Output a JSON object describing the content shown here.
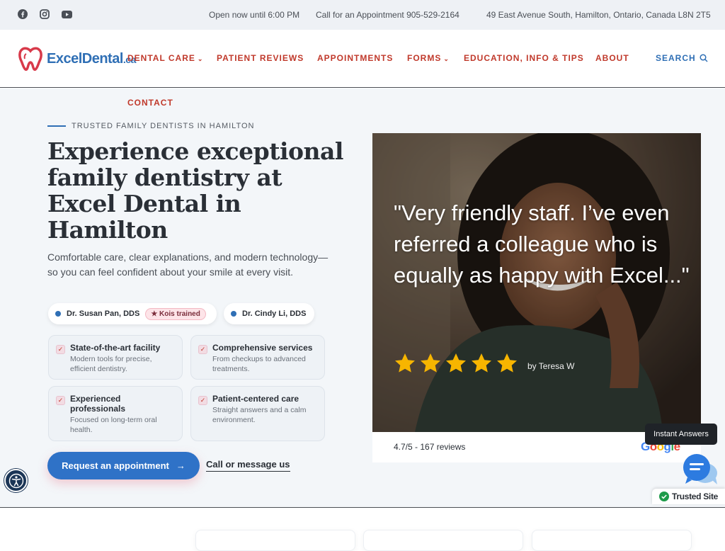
{
  "topbar": {
    "social": [
      "facebook-icon",
      "instagram-icon",
      "youtube-icon"
    ],
    "hours": "Open now until 6:00 PM",
    "phone": "Call for an Appointment  905-529-2164",
    "address": "49 East Avenue South, Hamilton, Ontario, Canada L8N 2T5"
  },
  "brand": {
    "name": "ExcelDental",
    "tld": ".ca",
    "color": "#2f6fb5",
    "accent": "#c0392b"
  },
  "nav": {
    "items": [
      {
        "label": "DENTAL CARE",
        "dropdown": true
      },
      {
        "label": "PATIENT REVIEWS",
        "dropdown": false
      },
      {
        "label": "APPOINTMENTS",
        "dropdown": false
      },
      {
        "label": "FORMS",
        "dropdown": true
      },
      {
        "label": "EDUCATION, INFO & TIPS",
        "dropdown": false
      },
      {
        "label": "ABOUT",
        "dropdown": false
      },
      {
        "label": "CONTACT",
        "dropdown": false
      }
    ],
    "search_label": "SEARCH"
  },
  "hero": {
    "eyebrow": "TRUSTED FAMILY DENTISTS IN HAMILTON",
    "headline": "Experience exceptional family dentistry at Excel Dental in Hamilton",
    "subtext": "Comfortable care, clear explanations, and modern technology—so you can feel confident about your smile at every visit.",
    "doctors": [
      {
        "name": "Dr. Susan Pan, DDS",
        "badge": "★ Kois trained"
      },
      {
        "name": "Dr. Cindy Li, DDS",
        "badge": ""
      }
    ],
    "features": [
      {
        "title": "State-of-the-art facility",
        "desc": "Modern tools for precise, efficient dentistry."
      },
      {
        "title": "Comprehensive services",
        "desc": "From checkups to advanced treatments."
      },
      {
        "title": "Experienced professionals",
        "desc": "Focused on long-term oral health."
      },
      {
        "title": "Patient-centered care",
        "desc": "Straight answers and a calm environment."
      }
    ],
    "cta_primary": "Request an appointment",
    "cta_secondary": "Call or message us"
  },
  "review": {
    "quote": "\"Very friendly staff. I’ve even referred a colleague who is equally as happy with Excel...\"",
    "stars": 5,
    "author": "by Teresa W",
    "rating_summary": "4.7/5 - 167 reviews",
    "provider": "Google"
  },
  "widgets": {
    "instant_answers": "Instant Answers",
    "trusted_site": "Trusted Site"
  }
}
